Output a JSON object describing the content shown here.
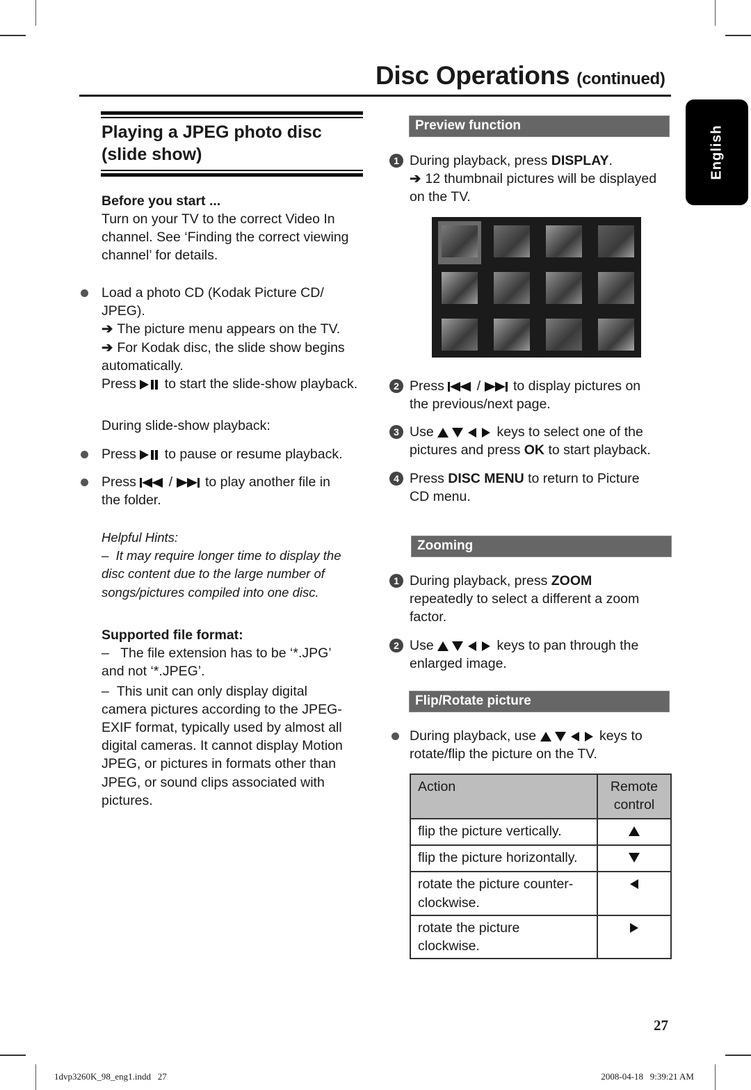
{
  "header": {
    "title": "Disc Operations",
    "title_suffix": "(continued)",
    "language_tab": "English"
  },
  "left": {
    "section_title": "Playing a JPEG photo disc (slide show)",
    "before_start": {
      "heading": "Before you start ...",
      "text": "Turn on your TV to the correct Video In channel. See ‘Finding the correct viewing channel’ for details."
    },
    "load_item": {
      "line1": "Load a photo CD (Kodak Picture CD/",
      "line2": "JPEG).",
      "result1": "The picture menu appears on the TV.",
      "result2a": "For Kodak disc, the slide show begins",
      "result2b": "automatically.",
      "press_pre": "Press",
      "press_post": "to start the slide-show playback."
    },
    "during_label": "During slide-show playback:",
    "pause_item": {
      "pre": "Press",
      "post": "to pause or resume playback."
    },
    "skip_item": {
      "pre": "Press",
      "sep": "/",
      "post": "to play another file in",
      "line2": "the folder."
    },
    "hints": {
      "heading": "Helpful Hints:",
      "dash": "–",
      "line1": "It may require longer time to display the",
      "line2": "disc content due to the large number of",
      "line3": "songs/pictures compiled into one disc."
    },
    "formats": {
      "heading": "Supported file format:",
      "dash": "–",
      "item1a": "The file extension has to be ‘*.JPG’",
      "item1b": "and not ‘*.JPEG’.",
      "item2a": "This unit can only display digital",
      "item2b": "camera pictures according to the JPEG-",
      "item2c": "EXIF format, typically used by almost all",
      "item2d": "digital cameras. It cannot display Motion",
      "item2e": "JPEG, or pictures in formats other than",
      "item2f": "JPEG, or sound clips associated with",
      "item2g": "pictures."
    }
  },
  "right": {
    "preview": {
      "heading": "Preview function",
      "step1": {
        "num": "1",
        "pre": "During playback, press",
        "key": "DISPLAY",
        "post": ".",
        "result_a": "12 thumbnail pictures will be displayed",
        "result_b": "on the TV."
      },
      "thumbnail_count": 12,
      "selected_thumbnail": 1,
      "step2": {
        "num": "2",
        "pre": "Press",
        "sep": "/",
        "post": "to display pictures on",
        "line2": "the previous/next page."
      },
      "step3": {
        "num": "3",
        "pre": "Use",
        "post": "keys to select one of the",
        "line2_pre": "pictures and press",
        "key": "OK",
        "line2_post": "to start playback."
      },
      "step4": {
        "num": "4",
        "pre": "Press",
        "key": "DISC MENU",
        "post": "to return to Picture",
        "line2": "CD menu."
      }
    },
    "zooming": {
      "heading": "Zooming",
      "step1": {
        "num": "1",
        "pre": "During playback, press",
        "key": "ZOOM",
        "line2": "repeatedly to select a different a zoom",
        "line3": "factor."
      },
      "step2": {
        "num": "2",
        "pre": "Use",
        "post": "keys to pan through the",
        "line2": "enlarged image."
      }
    },
    "flip": {
      "heading": "Flip/Rotate picture",
      "item": {
        "pre": "During playback, use",
        "post": "keys to",
        "line2": "rotate/flip the picture on the TV."
      },
      "table": {
        "col_action": "Action",
        "col_remote_a": "Remote",
        "col_remote_b": "control",
        "rows": [
          {
            "action_a": "flip the picture vertically.",
            "action_b": "",
            "key": "up"
          },
          {
            "action_a": "flip the picture horizontally.",
            "action_b": "",
            "key": "down"
          },
          {
            "action_a": "rotate the picture counter-",
            "action_b": "clockwise.",
            "key": "left"
          },
          {
            "action_a": "rotate the picture",
            "action_b": "clockwise.",
            "key": "right"
          }
        ]
      }
    }
  },
  "footer": {
    "page_number": "27",
    "file_name": "1dvp3260K_98_eng1.indd   27",
    "timestamp": "2008-04-18   9:39:21 AM"
  }
}
